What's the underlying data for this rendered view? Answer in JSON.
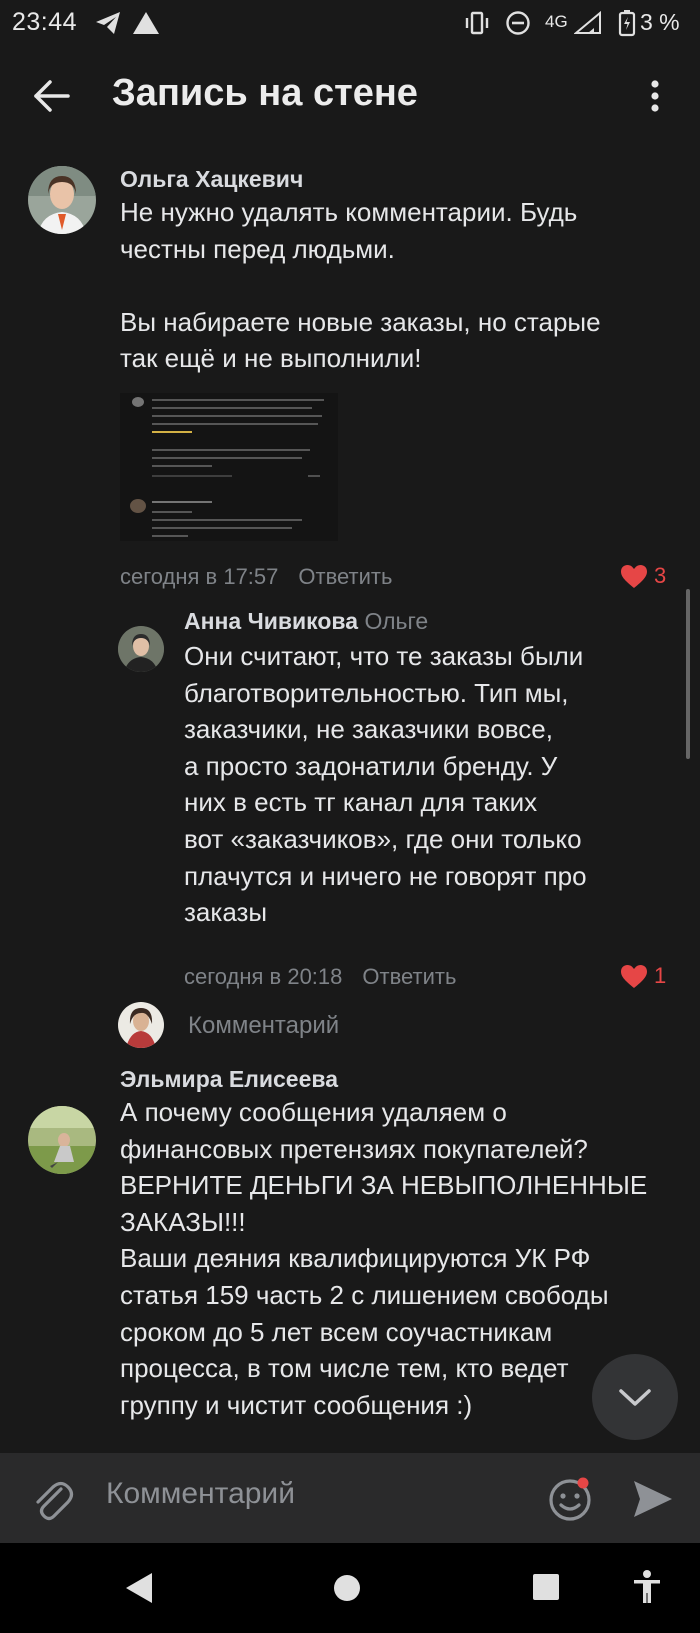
{
  "status_bar": {
    "time": "23:44",
    "network": "4G",
    "battery": "3 %",
    "icons": [
      "telegram-icon",
      "warning-triangle-icon",
      "vibrate-icon",
      "do-not-disturb-icon",
      "signal-icon",
      "battery-icon"
    ]
  },
  "header": {
    "title": "Запись на стене",
    "icons": [
      "back-arrow-icon",
      "more-vertical-icon"
    ]
  },
  "comments": [
    {
      "author": "Ольга Хацкевич",
      "text": "Не нужно удалять комментарии. Будь\nчестны перед людьми.\n\nВы набираете новые заказы, но старые\nтак ещё и не выполнили!",
      "time": "сегодня в 17:57",
      "reply_label": "Ответить",
      "likes": "3"
    },
    {
      "author": "Анна Чивикова",
      "reply_to": "Ольге",
      "text": "Они считают, что те заказы были\nблаготворительностью. Тип мы,\nзаказчики, не заказчики вовсе,\nа просто задонатили бренду. У\nних в есть тг канал для таких\nвот «заказчиков», где они только\nплачутся и ничего не говорят про\nзаказы",
      "time": "сегодня в 20:18",
      "reply_label": "Ответить",
      "likes": "1"
    },
    {
      "author": "Эльмира Елисеева",
      "text": "А почему сообщения удаляем о\nфинансовых претензиях покупателей?\nВЕРНИТЕ ДЕНЬГИ ЗА НЕВЫПОЛНЕННЫЕ\nЗАКАЗЫ!!!\nВаши деяния квалифицируются УК РФ\nстатья 159 часть 2 с лишением свободы\nсроком до 5 лет всем соучастникам\nпроцесса, в том числе тем, кто ведет\nгруппу и чистит сообщения :)"
    }
  ],
  "thread_reply_placeholder": "Комментарий",
  "composer": {
    "placeholder": "Комментарий",
    "icons": [
      "paperclip-icon",
      "emoji-icon",
      "send-icon"
    ]
  },
  "colors": {
    "background": "#191919",
    "like_red": "#e64646",
    "muted_text": "#7f8388"
  }
}
